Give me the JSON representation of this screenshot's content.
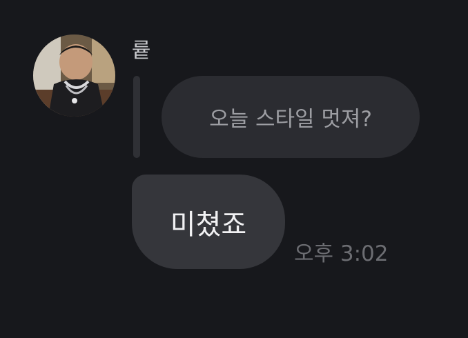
{
  "message": {
    "sender_name": "륱",
    "quoted_text": "오늘 스타일 멋져?",
    "text": "미쳤죠",
    "timestamp": "오후 3:02"
  },
  "colors": {
    "background": "#17181c",
    "bubble": "#35363b",
    "quoted_bubble": "#2b2c31"
  }
}
